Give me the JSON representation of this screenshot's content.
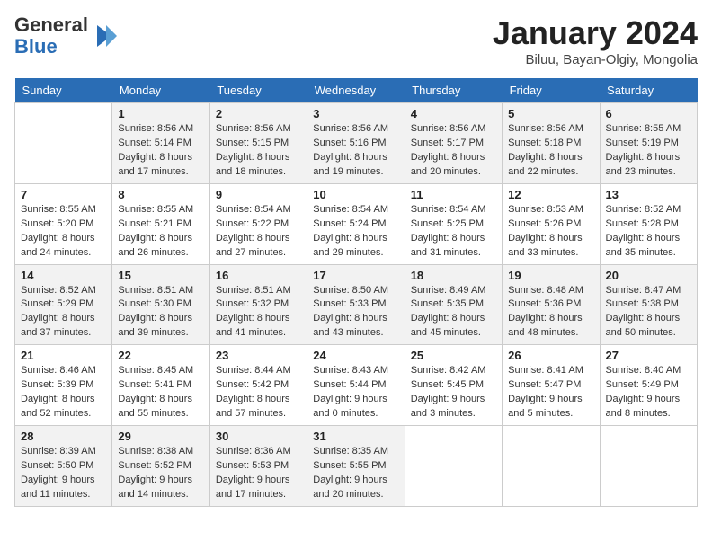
{
  "header": {
    "logo_general": "General",
    "logo_blue": "Blue",
    "month_title": "January 2024",
    "location": "Biluu, Bayan-Olgiy, Mongolia"
  },
  "days_of_week": [
    "Sunday",
    "Monday",
    "Tuesday",
    "Wednesday",
    "Thursday",
    "Friday",
    "Saturday"
  ],
  "weeks": [
    [
      {
        "day": null
      },
      {
        "day": 1,
        "sunrise": "8:56 AM",
        "sunset": "5:14 PM",
        "daylight": "8 hours and 17 minutes."
      },
      {
        "day": 2,
        "sunrise": "8:56 AM",
        "sunset": "5:15 PM",
        "daylight": "8 hours and 18 minutes."
      },
      {
        "day": 3,
        "sunrise": "8:56 AM",
        "sunset": "5:16 PM",
        "daylight": "8 hours and 19 minutes."
      },
      {
        "day": 4,
        "sunrise": "8:56 AM",
        "sunset": "5:17 PM",
        "daylight": "8 hours and 20 minutes."
      },
      {
        "day": 5,
        "sunrise": "8:56 AM",
        "sunset": "5:18 PM",
        "daylight": "8 hours and 22 minutes."
      },
      {
        "day": 6,
        "sunrise": "8:55 AM",
        "sunset": "5:19 PM",
        "daylight": "8 hours and 23 minutes."
      }
    ],
    [
      {
        "day": 7,
        "sunrise": "8:55 AM",
        "sunset": "5:20 PM",
        "daylight": "8 hours and 24 minutes."
      },
      {
        "day": 8,
        "sunrise": "8:55 AM",
        "sunset": "5:21 PM",
        "daylight": "8 hours and 26 minutes."
      },
      {
        "day": 9,
        "sunrise": "8:54 AM",
        "sunset": "5:22 PM",
        "daylight": "8 hours and 27 minutes."
      },
      {
        "day": 10,
        "sunrise": "8:54 AM",
        "sunset": "5:24 PM",
        "daylight": "8 hours and 29 minutes."
      },
      {
        "day": 11,
        "sunrise": "8:54 AM",
        "sunset": "5:25 PM",
        "daylight": "8 hours and 31 minutes."
      },
      {
        "day": 12,
        "sunrise": "8:53 AM",
        "sunset": "5:26 PM",
        "daylight": "8 hours and 33 minutes."
      },
      {
        "day": 13,
        "sunrise": "8:52 AM",
        "sunset": "5:28 PM",
        "daylight": "8 hours and 35 minutes."
      }
    ],
    [
      {
        "day": 14,
        "sunrise": "8:52 AM",
        "sunset": "5:29 PM",
        "daylight": "8 hours and 37 minutes."
      },
      {
        "day": 15,
        "sunrise": "8:51 AM",
        "sunset": "5:30 PM",
        "daylight": "8 hours and 39 minutes."
      },
      {
        "day": 16,
        "sunrise": "8:51 AM",
        "sunset": "5:32 PM",
        "daylight": "8 hours and 41 minutes."
      },
      {
        "day": 17,
        "sunrise": "8:50 AM",
        "sunset": "5:33 PM",
        "daylight": "8 hours and 43 minutes."
      },
      {
        "day": 18,
        "sunrise": "8:49 AM",
        "sunset": "5:35 PM",
        "daylight": "8 hours and 45 minutes."
      },
      {
        "day": 19,
        "sunrise": "8:48 AM",
        "sunset": "5:36 PM",
        "daylight": "8 hours and 48 minutes."
      },
      {
        "day": 20,
        "sunrise": "8:47 AM",
        "sunset": "5:38 PM",
        "daylight": "8 hours and 50 minutes."
      }
    ],
    [
      {
        "day": 21,
        "sunrise": "8:46 AM",
        "sunset": "5:39 PM",
        "daylight": "8 hours and 52 minutes."
      },
      {
        "day": 22,
        "sunrise": "8:45 AM",
        "sunset": "5:41 PM",
        "daylight": "8 hours and 55 minutes."
      },
      {
        "day": 23,
        "sunrise": "8:44 AM",
        "sunset": "5:42 PM",
        "daylight": "8 hours and 57 minutes."
      },
      {
        "day": 24,
        "sunrise": "8:43 AM",
        "sunset": "5:44 PM",
        "daylight": "9 hours and 0 minutes."
      },
      {
        "day": 25,
        "sunrise": "8:42 AM",
        "sunset": "5:45 PM",
        "daylight": "9 hours and 3 minutes."
      },
      {
        "day": 26,
        "sunrise": "8:41 AM",
        "sunset": "5:47 PM",
        "daylight": "9 hours and 5 minutes."
      },
      {
        "day": 27,
        "sunrise": "8:40 AM",
        "sunset": "5:49 PM",
        "daylight": "9 hours and 8 minutes."
      }
    ],
    [
      {
        "day": 28,
        "sunrise": "8:39 AM",
        "sunset": "5:50 PM",
        "daylight": "9 hours and 11 minutes."
      },
      {
        "day": 29,
        "sunrise": "8:38 AM",
        "sunset": "5:52 PM",
        "daylight": "9 hours and 14 minutes."
      },
      {
        "day": 30,
        "sunrise": "8:36 AM",
        "sunset": "5:53 PM",
        "daylight": "9 hours and 17 minutes."
      },
      {
        "day": 31,
        "sunrise": "8:35 AM",
        "sunset": "5:55 PM",
        "daylight": "9 hours and 20 minutes."
      },
      {
        "day": null
      },
      {
        "day": null
      },
      {
        "day": null
      }
    ]
  ]
}
